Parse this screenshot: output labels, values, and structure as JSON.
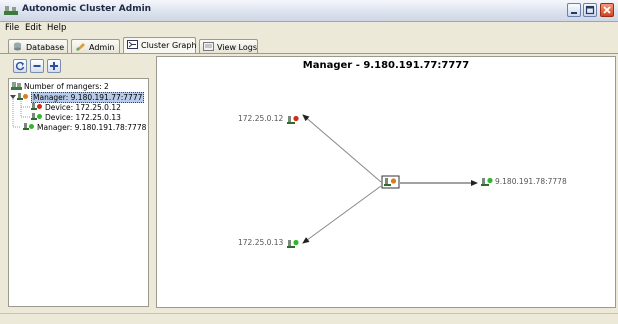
{
  "window": {
    "title": "Autonomic Cluster Admin"
  },
  "menu": {
    "file": "File",
    "edit": "Edit",
    "help": "Help"
  },
  "tabs": [
    {
      "label": "Database",
      "icon": "database-icon",
      "active": false
    },
    {
      "label": "Admin",
      "icon": "admin-icon",
      "active": false
    },
    {
      "label": "Cluster Graph",
      "icon": "cluster-graph-icon",
      "active": true
    },
    {
      "label": "View Logs",
      "icon": "logs-icon",
      "active": false
    }
  ],
  "tree": {
    "root": "Number of mangers: 2",
    "nodes": [
      {
        "label": "Manager: 9.180.191.77:7777",
        "status": "#e07a1f",
        "selected": true
      },
      {
        "label": "Device: 172.25.0.12",
        "status": "#d42a1a"
      },
      {
        "label": "Device: 172.25.0.13",
        "status": "#2fb82f"
      },
      {
        "label": "Manager: 9.180.191.78:7778",
        "status": "#2fb82f"
      }
    ]
  },
  "graph": {
    "title": "Manager - 9.180.191.77:7777",
    "device_top": "172.25.0.12",
    "device_bottom": "172.25.0.13",
    "manager_remote": "9.180.191.78:7778",
    "colors": {
      "red": "#d42a1a",
      "green": "#2fb82f",
      "orange": "#e07a1f"
    }
  }
}
